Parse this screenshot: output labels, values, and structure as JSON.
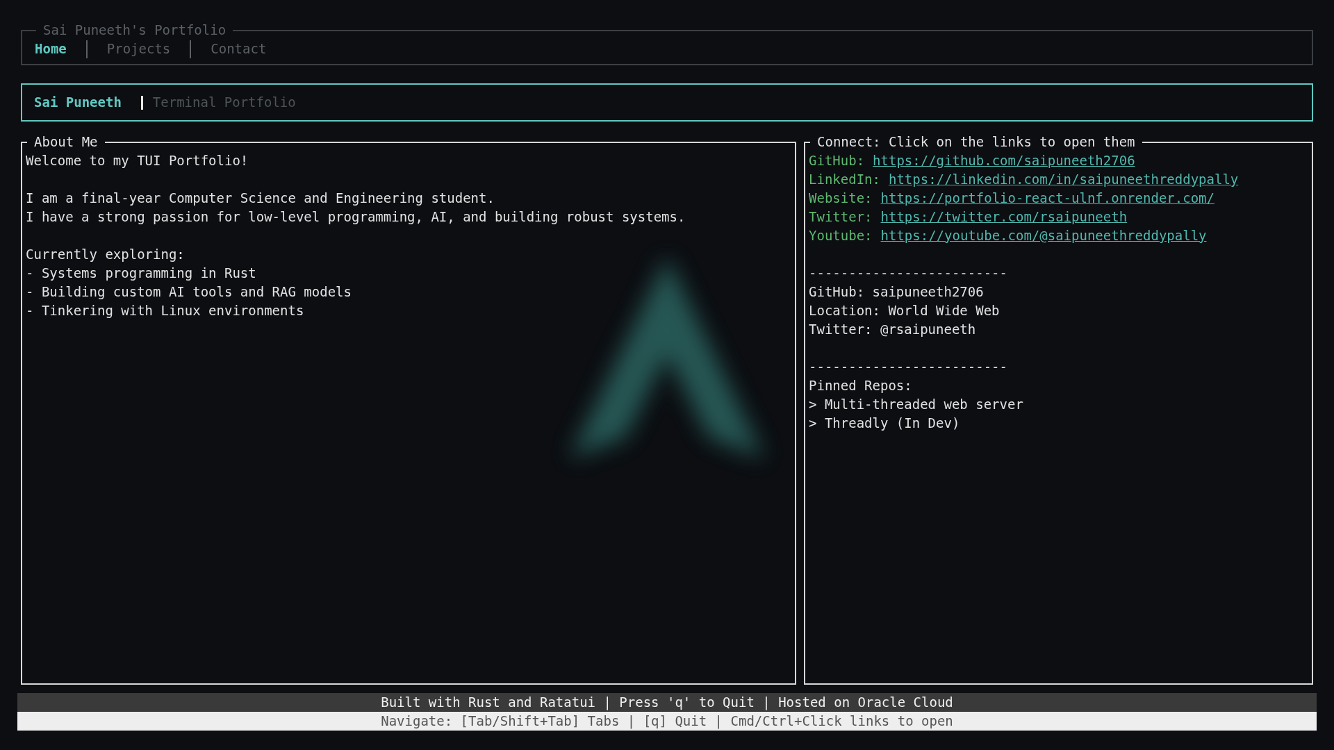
{
  "window_title": "Sai Puneeth's Portfolio",
  "tabs": [
    {
      "label": "Home",
      "selected": true
    },
    {
      "label": "Projects",
      "selected": false
    },
    {
      "label": "Contact",
      "selected": false
    }
  ],
  "header": {
    "name": "Sai Puneeth",
    "subtitle": "Terminal Portfolio"
  },
  "about": {
    "title": "About Me",
    "paragraphs": [
      [
        "Welcome to my TUI Portfolio!"
      ],
      [
        "I am a final-year Computer Science and Engineering student.",
        "I have a strong passion for low-level programming, AI, and building robust systems."
      ],
      [
        "Currently exploring:",
        "- Systems programming in Rust",
        "- Building custom AI tools and RAG models",
        "- Tinkering with Linux environments"
      ]
    ]
  },
  "connect": {
    "title": "Connect: Click on the links to open them",
    "links": [
      {
        "label": "GitHub:",
        "url": "https://github.com/saipuneeth2706"
      },
      {
        "label": "LinkedIn:",
        "url": "https://linkedin.com/in/saipuneethreddypally"
      },
      {
        "label": "Website:",
        "url": "https://portfolio-react-ulnf.onrender.com/"
      },
      {
        "label": "Twitter:",
        "url": "https://twitter.com/rsaipuneeth"
      },
      {
        "label": "Youtube:",
        "url": "https://youtube.com/@saipuneethreddypally"
      }
    ],
    "profile": {
      "divider": "-------------------------",
      "lines": [
        "GitHub: saipuneeth2706",
        "Location: World Wide Web",
        "Twitter: @rsaipuneeth"
      ]
    },
    "pinned": {
      "divider": "-------------------------",
      "heading": "Pinned Repos:",
      "repos": [
        "> Multi-threaded web server",
        "> Threadly (In Dev)"
      ]
    }
  },
  "status_bar": {
    "primary": "Built with Rust and Ratatui | Press 'q' to Quit | Hosted on Oracle Cloud",
    "secondary": "Navigate: [Tab/Shift+Tab] Tabs | [q] Quit | Cmd/Ctrl+Click links to open"
  }
}
